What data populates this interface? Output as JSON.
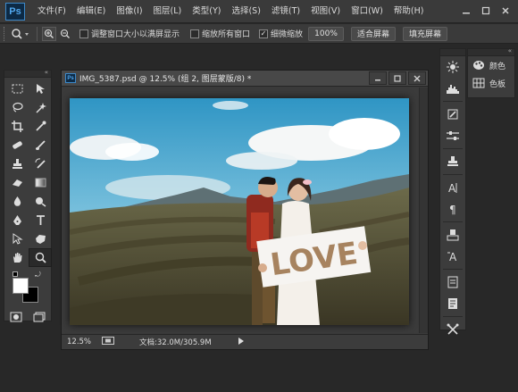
{
  "app": {
    "logo": "Ps",
    "menu": [
      "文件(F)",
      "编辑(E)",
      "图像(I)",
      "图层(L)",
      "类型(Y)",
      "选择(S)",
      "滤镜(T)",
      "视图(V)",
      "窗口(W)",
      "帮助(H)"
    ],
    "window_controls": [
      "minimize-icon",
      "restore-icon",
      "close-icon"
    ]
  },
  "options_bar": {
    "tool_icon": "zoom-icon",
    "checkbox_resize_windows": {
      "label": "调整窗口大小以满屏显示",
      "checked": false
    },
    "checkbox_zoom_all": {
      "label": "缩放所有窗口",
      "checked": false
    },
    "checkbox_scrubby": {
      "label": "细微缩放",
      "checked": true
    },
    "zoom_value": "100%",
    "fit_screen": "适合屏幕",
    "fill_screen": "填充屏幕"
  },
  "document": {
    "title": "IMG_5387.psd @ 12.5% (组 2, 图层蒙版/8) *",
    "photo_sign_text": "LOVE",
    "status_zoom": "12.5%",
    "status_doc": "文档:32.0M/305.9M"
  },
  "right_panels": {
    "color_label": "颜色",
    "swatches_label": "色板"
  },
  "colors": {
    "menu_bg": "#3a3a3a",
    "workspace_bg": "#282828",
    "ps_blue": "#52a8ee",
    "foreground": "#ffffff",
    "background": "#000000"
  }
}
